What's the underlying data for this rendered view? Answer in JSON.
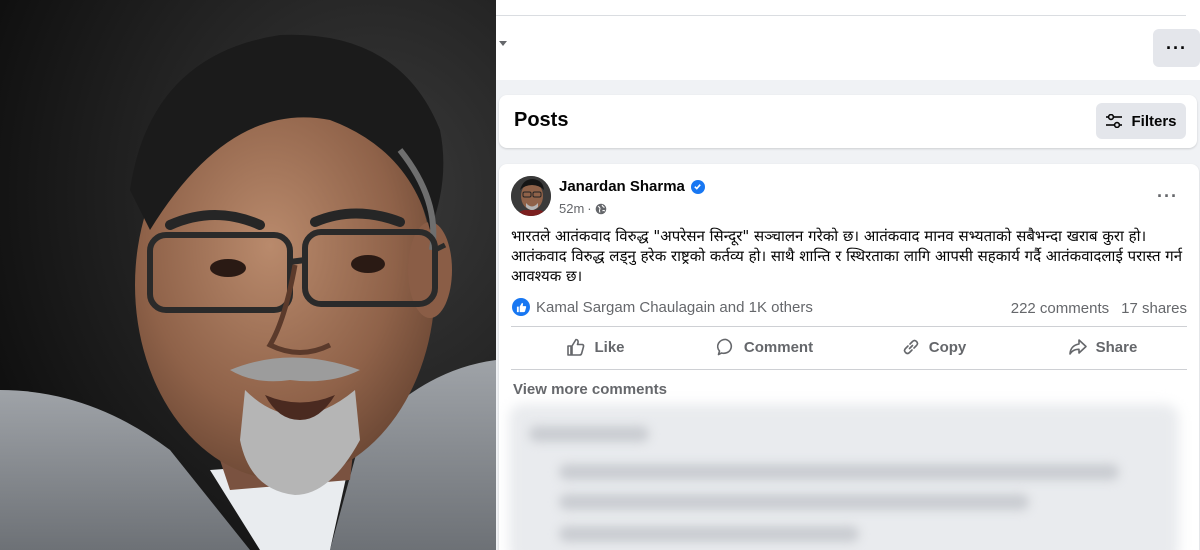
{
  "header": {
    "more_label": "···"
  },
  "posts_section": {
    "title": "Posts",
    "filters_label": "Filters"
  },
  "post": {
    "author": "Janardan Sharma",
    "verified": true,
    "time": "52m",
    "separator": "·",
    "visibility_icon": "globe-icon",
    "more_label": "···",
    "text": "भारतले आतंकवाद विरुद्ध \"अपरेसन सिन्दूर\" सञ्चालन गरेको छ। आतंकवाद मानव सभ्यताको सबैभन्दा खराब कुरा हो। आतंकवाद विरुद्ध लड्नु हरेक राष्ट्रको कर्तव्य हो। साथै शान्ति र स्थिरताका लागि आपसी सहकार्य गर्दै आतंकवादलाई परास्त गर्न आवश्यक छ।",
    "reactions_text": "Kamal Sargam Chaulagain and 1K others",
    "comments_count": "222 comments",
    "shares_count": "17 shares",
    "actions": {
      "like": "Like",
      "comment": "Comment",
      "copy": "Copy",
      "share": "Share"
    },
    "view_more_comments": "View more comments"
  },
  "colors": {
    "accent": "#1877f2",
    "secondary_text": "#65676b",
    "background": "#f0f2f5"
  }
}
